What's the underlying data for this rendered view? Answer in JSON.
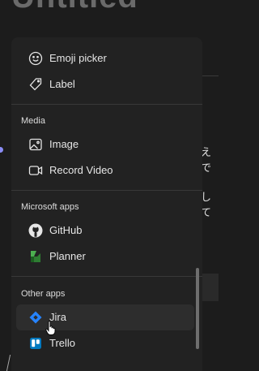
{
  "background": {
    "jp_text_1": "えで",
    "jp_text_2": "して"
  },
  "menu": {
    "top_items": [
      {
        "label": "Emoji picker",
        "icon": "emoji-icon"
      },
      {
        "label": "Label",
        "icon": "tag-icon"
      }
    ],
    "sections": [
      {
        "title": "Media",
        "items": [
          {
            "label": "Image",
            "icon": "image-icon"
          },
          {
            "label": "Record Video",
            "icon": "video-camera-icon"
          }
        ]
      },
      {
        "title": "Microsoft apps",
        "items": [
          {
            "label": "GitHub",
            "icon": "github-icon"
          },
          {
            "label": "Planner",
            "icon": "planner-icon"
          }
        ]
      },
      {
        "title": "Other apps",
        "items": [
          {
            "label": "Jira",
            "icon": "jira-icon"
          },
          {
            "label": "Trello",
            "icon": "trello-icon"
          }
        ]
      }
    ],
    "hovered_item": "Jira"
  },
  "colors": {
    "menu_bg": "#222222",
    "hover_bg": "#2d2d2d",
    "jira_blue": "#2684ff",
    "trello_blue": "#0079bf",
    "planner_green": "#31752f"
  }
}
